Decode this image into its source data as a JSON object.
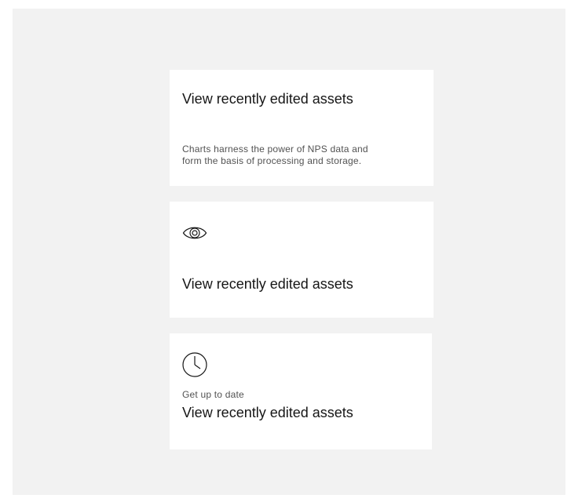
{
  "tiles": [
    {
      "title": "View recently edited assets",
      "description": "Charts harness the power of NPS data and form the basis of processing and storage."
    },
    {
      "icon": "eye-icon",
      "title": "View recently edited assets"
    },
    {
      "icon": "clock-icon",
      "eyebrow": "Get up to date",
      "title": "View recently edited assets"
    }
  ],
  "colors": {
    "background": "#f2f2f2",
    "tile": "#ffffff",
    "text_primary": "#161616",
    "text_secondary": "#525252"
  }
}
